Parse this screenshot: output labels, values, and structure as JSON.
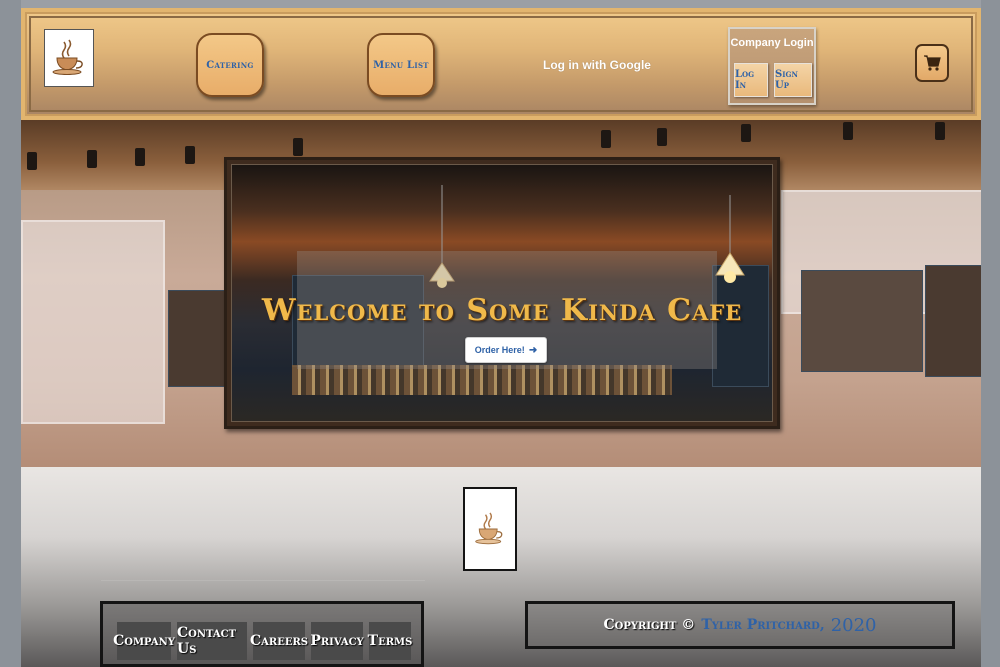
{
  "header": {
    "nav": [
      {
        "label": "Catering"
      },
      {
        "label": "Menu List"
      }
    ],
    "google_login": "Log in with Google",
    "company_login": {
      "title": "Company Login",
      "login_label": "Log In",
      "signup_label": "Sign Up"
    }
  },
  "hero": {
    "title": "Welcome to Some Kinda Cafe",
    "cta_label": "Order Here!"
  },
  "footer": {
    "links": [
      "Company",
      "Contact Us",
      "Careers",
      "Privacy",
      "Terms"
    ],
    "copyright_label": "Copyright ©",
    "copyright_name": "Tyler Pritchard,",
    "copyright_year": "2020"
  },
  "colors": {
    "link_blue": "#2f62a7",
    "accent_orange": "#e8ad69",
    "title_gold": "#f0b94a"
  },
  "icons": {
    "logo": "coffee-cup-icon",
    "cart": "shopping-cart-icon",
    "cta_arrow": "arrow-right-icon"
  }
}
